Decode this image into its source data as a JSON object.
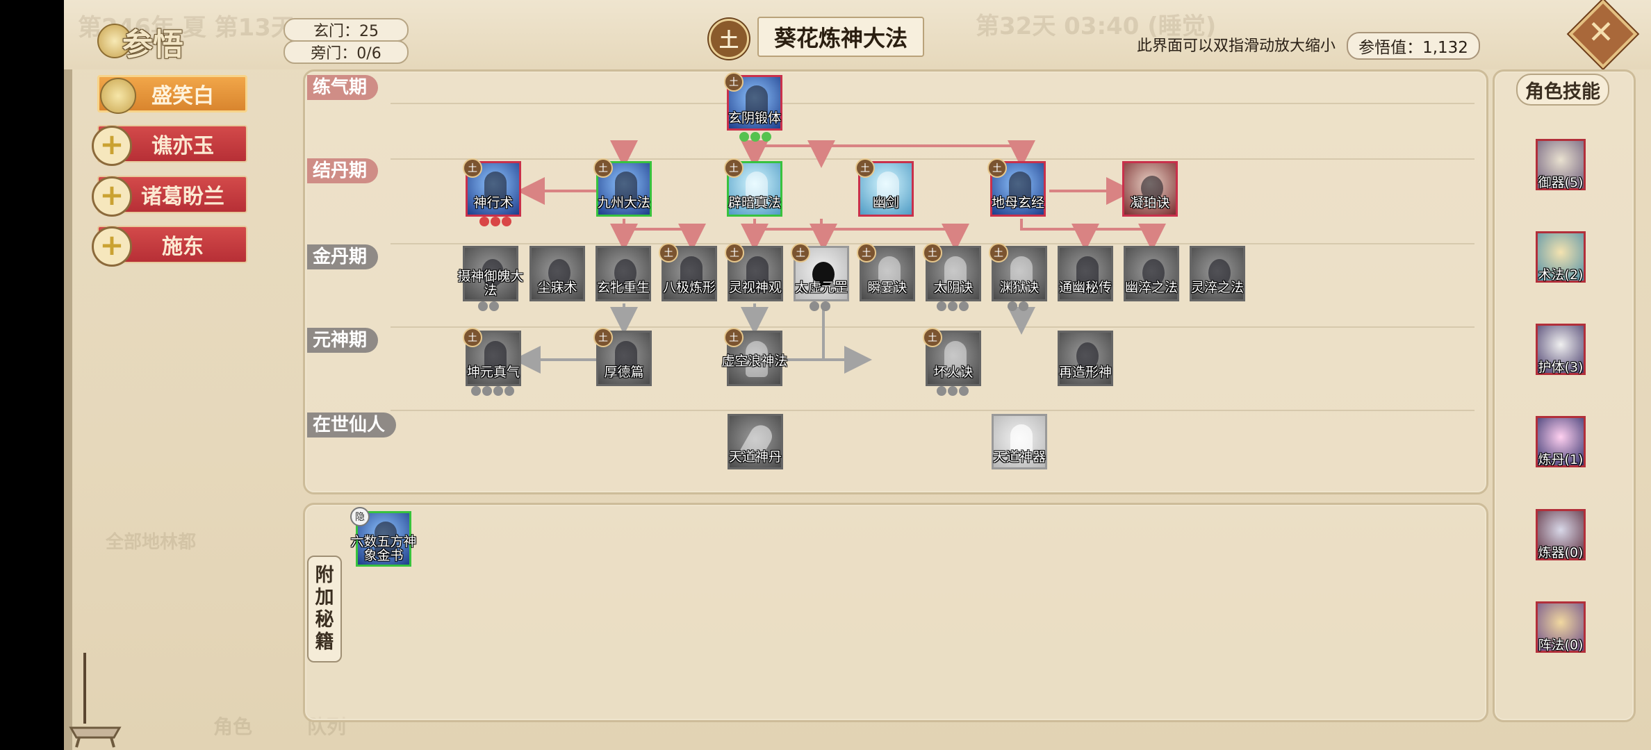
{
  "header": {
    "title": "参悟",
    "xuanmen": "玄门：25",
    "pangmen": "旁门：0/6",
    "element_badge": "土",
    "technique_name": "葵花炼神大法",
    "hint": "此界面可以双指滑动放大缩小",
    "canwu_value": "参悟值：1,132"
  },
  "background_faint": {
    "year": "第246年 夏 第13天",
    "time": "第32天 03:40 (睡觉)",
    "bottom_left": "角色",
    "bottom_mid": "队列",
    "side_label": "全部地林都"
  },
  "characters": [
    {
      "name": "盛笑白",
      "active": true
    },
    {
      "name": "谯亦玉",
      "active": false
    },
    {
      "name": "诸葛盼兰",
      "active": false
    },
    {
      "name": "施东",
      "active": false
    }
  ],
  "stages": [
    "练气期",
    "结丹期",
    "金丹期",
    "元神期",
    "在世仙人"
  ],
  "skills": {
    "xuanyin": "玄阴锻体",
    "shenxing": "神行术",
    "jiuzhou": "九州大法",
    "pian": "辟暗真法",
    "youjian": "幽剑",
    "dimu": "地母玄经",
    "ningpo": "凝珀诀",
    "shese": "摄神御魄大法",
    "chenmo": "尘寐术",
    "xuanli": "玄牝重生",
    "baji": "八极炼形",
    "lingshi": "灵视神观",
    "taixu": "太虚元罡",
    "shunmeng": "瞬霎诀",
    "taiyin": "太阴诀",
    "yuanyu": "渊狱诀",
    "tongyou": "通幽秘传",
    "youcui": "幽淬之法",
    "lingcui": "灵淬之法",
    "kunyuan": "坤元真气",
    "houde": "厚德篇",
    "xukong": "虚空浪神法",
    "huaihuo": "坏火诀",
    "zaizao": "再造形神",
    "tiandao_dan": "天道神丹",
    "tiandao_qi": "天道神器"
  },
  "attached": {
    "tab": [
      "附",
      "加",
      "秘",
      "籍"
    ],
    "book": "六数五方神象金书",
    "book_badge": "隐"
  },
  "role_skills": {
    "title": "角色技能",
    "items": [
      "御器(5)",
      "术法(2)",
      "护体(3)",
      "炼丹(1)",
      "炼器(0)",
      "阵法(0)"
    ]
  },
  "colors": {
    "accent_red": "#c9304b",
    "accent_green": "#38c23e",
    "active_orange": "#e79a3f",
    "panel_bg": "#e9dcc1"
  }
}
